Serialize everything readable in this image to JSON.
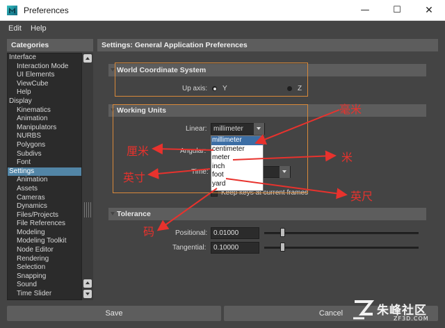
{
  "window": {
    "title": "Preferences",
    "minimize": "—",
    "maximize": "☐",
    "close": "✕"
  },
  "menu": {
    "items": [
      "Edit",
      "Help"
    ]
  },
  "categories": {
    "header": "Categories",
    "items": [
      {
        "label": "Interface",
        "level": 0
      },
      {
        "label": "Interaction Mode",
        "level": 1
      },
      {
        "label": "UI Elements",
        "level": 1
      },
      {
        "label": "ViewCube",
        "level": 1
      },
      {
        "label": "Help",
        "level": 1
      },
      {
        "label": "Display",
        "level": 0
      },
      {
        "label": "Kinematics",
        "level": 1
      },
      {
        "label": "Animation",
        "level": 1
      },
      {
        "label": "Manipulators",
        "level": 1
      },
      {
        "label": "NURBS",
        "level": 1
      },
      {
        "label": "Polygons",
        "level": 1
      },
      {
        "label": "Subdivs",
        "level": 1
      },
      {
        "label": "Font",
        "level": 1
      },
      {
        "label": "Settings",
        "level": 0,
        "selected": true
      },
      {
        "label": "Animation",
        "level": 1
      },
      {
        "label": "Assets",
        "level": 1
      },
      {
        "label": "Cameras",
        "level": 1
      },
      {
        "label": "Dynamics",
        "level": 1
      },
      {
        "label": "Files/Projects",
        "level": 1
      },
      {
        "label": "File References",
        "level": 1
      },
      {
        "label": "Modeling",
        "level": 1
      },
      {
        "label": "Modeling Toolkit",
        "level": 1
      },
      {
        "label": "Node Editor",
        "level": 1
      },
      {
        "label": "Rendering",
        "level": 1
      },
      {
        "label": "Selection",
        "level": 1
      },
      {
        "label": "Snapping",
        "level": 1
      },
      {
        "label": "Sound",
        "level": 1
      },
      {
        "label": "Time Slider",
        "level": 1
      }
    ]
  },
  "settings": {
    "header": "Settings: General Application Preferences",
    "world": {
      "title": "World Coordinate System",
      "up_axis_label": "Up axis:",
      "y_label": "Y",
      "z_label": "Z",
      "selected": "Y"
    },
    "units": {
      "title": "Working Units",
      "linear_label": "Linear:",
      "linear_value": "millimeter",
      "angular_label": "Angular:",
      "time_label": "Time:",
      "dropdown_options": [
        "millimeter",
        "centimeter",
        "meter",
        "inch",
        "foot",
        "yard"
      ],
      "highlighted": "millimeter",
      "keep_keys_label": "Keep keys at current frames"
    },
    "tolerance": {
      "title": "Tolerance",
      "positional_label": "Positional:",
      "positional_value": "0.01000",
      "tangential_label": "Tangential:",
      "tangential_value": "0.10000"
    }
  },
  "buttons": {
    "save": "Save",
    "cancel": "Cancel"
  },
  "annotations": {
    "millimeter": "毫米",
    "centimeter": "厘米",
    "meter": "米",
    "inch": "英寸",
    "foot": "英尺",
    "yard": "码"
  },
  "annotation_color": "#e8322d",
  "highlight_box_color": "#d9893a",
  "watermark": {
    "text": "朱峰社区",
    "sub": "ZF3D.COM"
  }
}
